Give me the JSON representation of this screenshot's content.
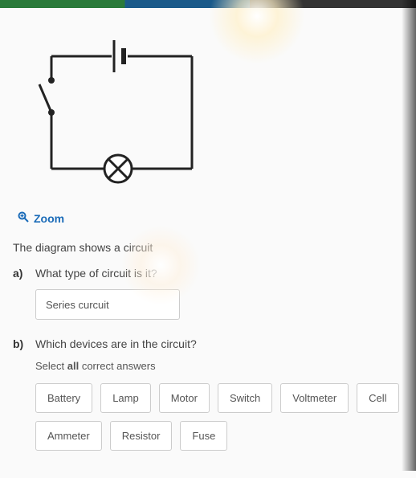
{
  "zoom": {
    "label": "Zoom"
  },
  "prompt": "The diagram shows a circuit",
  "qa": {
    "label": "a)",
    "text": "What type of circuit is it?",
    "input_value": "Series curcuit"
  },
  "qb": {
    "label": "b)",
    "text": "Which devices are in the circuit?",
    "instruction_pre": "Select ",
    "instruction_bold": "all",
    "instruction_post": " correct answers",
    "options": [
      "Battery",
      "Lamp",
      "Motor",
      "Switch",
      "Voltmeter",
      "Cell",
      "Ammeter",
      "Resistor",
      "Fuse"
    ]
  }
}
